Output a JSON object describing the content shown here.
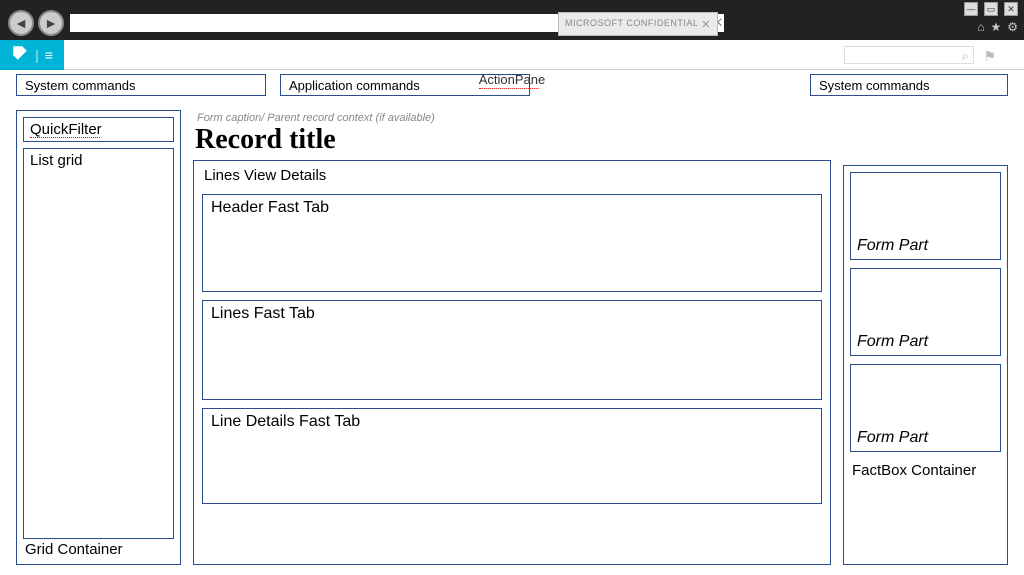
{
  "browser": {
    "tab_label": "MICROSOFT CONFIDENTIAL",
    "search_suffix": "⌕ ▾  ↻ ✕"
  },
  "actionpane": {
    "label": "ActionPane",
    "sys_commands_left": "System commands",
    "app_commands": "Application commands",
    "sys_commands_right": "System commands"
  },
  "left": {
    "quickfilter": "QuickFilter",
    "listgrid": "List grid",
    "container_label": "Grid Container"
  },
  "center": {
    "form_caption": "Form caption/ Parent record context (if available)",
    "record_title": "Record title",
    "details_label": "Lines View Details",
    "fasttab1": "Header Fast Tab",
    "fasttab2": "Lines Fast Tab",
    "fasttab3": "Line Details Fast Tab"
  },
  "right": {
    "formpart1": "Form Part",
    "formpart2": "Form Part",
    "formpart3": "Form Part",
    "container_label": "FactBox Container"
  }
}
